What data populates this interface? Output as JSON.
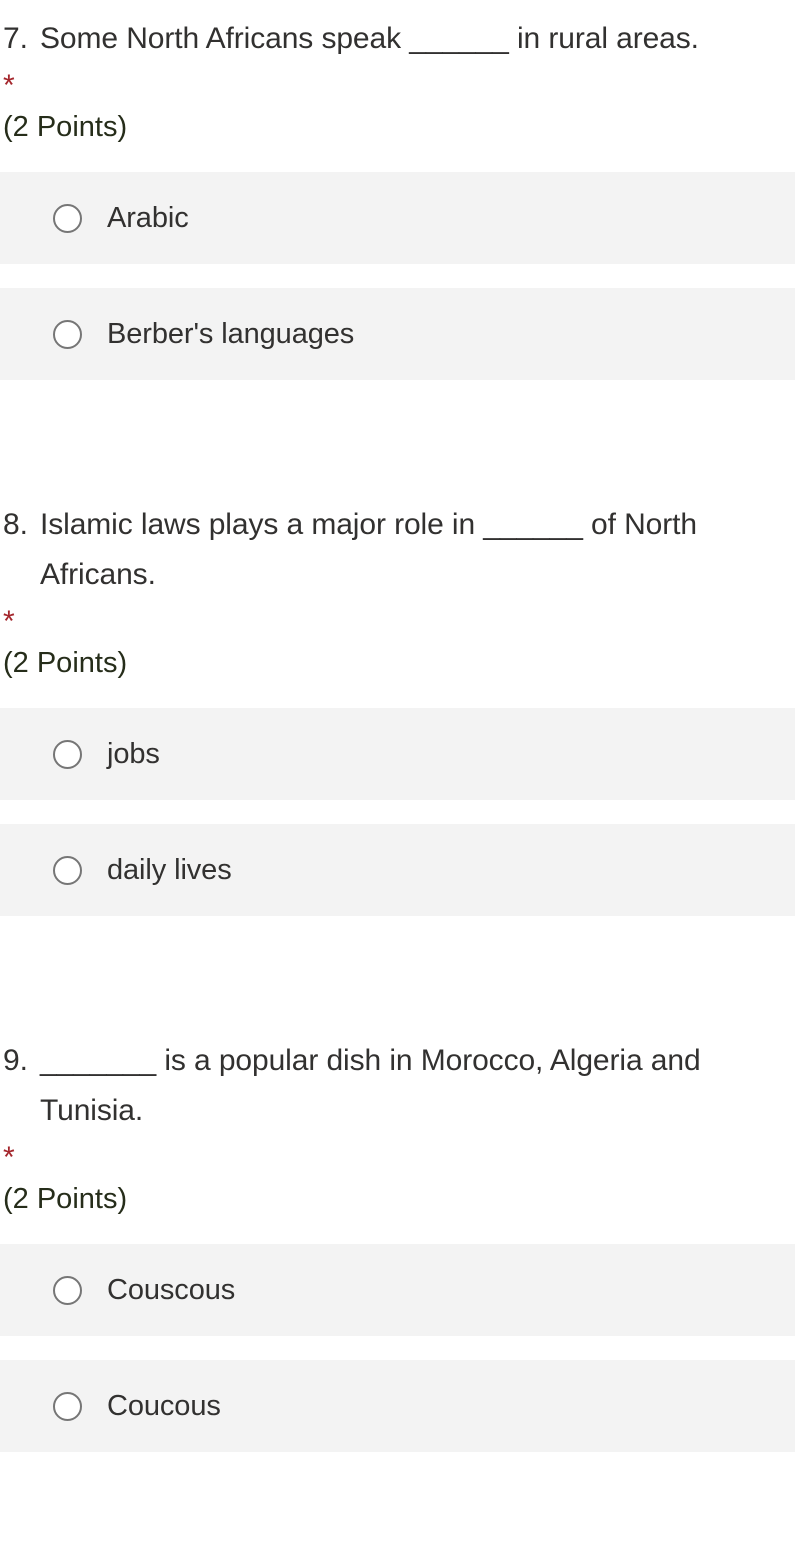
{
  "form": {
    "required_marker": "*",
    "questions": [
      {
        "number": "7.",
        "text": "Some North Africans speak ______ in rural areas.",
        "required_marker": "*",
        "points": "(2 Points)",
        "options": [
          {
            "label": "Arabic",
            "selected": false
          },
          {
            "label": "Berber's languages",
            "selected": false
          }
        ]
      },
      {
        "number": "8.",
        "text": "Islamic laws plays a major role in ______ of North Africans.",
        "required_marker": "*",
        "points": "(2 Points)",
        "options": [
          {
            "label": "jobs",
            "selected": false
          },
          {
            "label": "daily lives",
            "selected": false
          }
        ]
      },
      {
        "number": "9.",
        "text": "_______ is a popular dish in Morocco, Algeria and Tunisia.",
        "required_marker": "*",
        "points": "(2 Points)",
        "options": [
          {
            "label": "Couscous",
            "selected": false
          },
          {
            "label": "Coucous",
            "selected": false
          }
        ]
      }
    ]
  },
  "colors": {
    "text": "#323130",
    "required": "#a4262c",
    "points": "#262d1a",
    "option_background": "#f3f3f3",
    "radio_border": "#767676",
    "page_background": "#ffffff"
  }
}
